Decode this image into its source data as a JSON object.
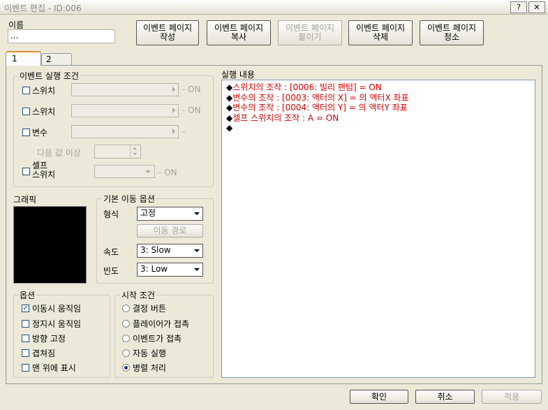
{
  "window": {
    "title": "이벤트 편집 - ID:006",
    "help_label": "?",
    "close_label": "✕"
  },
  "name": {
    "label": "이름",
    "value": "..."
  },
  "top_buttons": {
    "create": [
      "이벤트 페이지",
      "작성"
    ],
    "copy": [
      "이벤트 페이지",
      "복사"
    ],
    "paste": [
      "이벤트 페이지",
      "붙이기"
    ],
    "delete": [
      "이벤트 페이지",
      "삭제"
    ],
    "clear": [
      "이벤트 페이지",
      "청소"
    ]
  },
  "tabs": [
    {
      "label": "1"
    },
    {
      "label": "2"
    }
  ],
  "conditions": {
    "title": "이벤트 실행 조건",
    "switch1": {
      "label": "스위치",
      "suffix": "- ON"
    },
    "switch2": {
      "label": "스위치",
      "suffix": "- ON"
    },
    "variable": {
      "label": "변수",
      "suffix": "-",
      "sub_label": "다음 값 이상"
    },
    "self_switch": {
      "label1": "셀프",
      "label2": "스위치",
      "suffix": "- ON"
    }
  },
  "graphic": {
    "title": "그래픽"
  },
  "movement": {
    "title": "기본 이동 옵션",
    "type_label": "형식",
    "type_value": "고정",
    "route_button": "이동 경로",
    "speed_label": "속도",
    "speed_value": "3: Slow",
    "freq_label": "빈도",
    "freq_value": "3: Low"
  },
  "options": {
    "title": "옵션",
    "items": [
      {
        "label": "이동시 움직임",
        "checked": true
      },
      {
        "label": "정지시 움직임",
        "checked": false
      },
      {
        "label": "방향 고정",
        "checked": false
      },
      {
        "label": "겹쳐짐",
        "checked": false
      },
      {
        "label": "맨 위에 표시",
        "checked": false
      }
    ]
  },
  "trigger": {
    "title": "시작 조건",
    "items": [
      {
        "label": "결정 버튼",
        "checked": false
      },
      {
        "label": "플레이어가 접촉",
        "checked": false
      },
      {
        "label": "이벤트가 접촉",
        "checked": false
      },
      {
        "label": "자동 실행",
        "checked": false
      },
      {
        "label": "병렬 처리",
        "checked": true
      }
    ]
  },
  "contents": {
    "title": "실행 내용",
    "lines": [
      {
        "bullet": "◆",
        "text": "스위치의 조작 : [0006: 빌리 팬텀] = ON"
      },
      {
        "bullet": "◆",
        "text": "변수의 조작 : [0003: 액터의 X] = 의 액터X 좌표"
      },
      {
        "bullet": "◆",
        "text": "변수의 조작 : [0004: 액터의 Y] = 의 액터Y 좌표"
      },
      {
        "bullet": "◆",
        "text": "셀프 스위치의 조작 : A = ON"
      },
      {
        "bullet": "◆",
        "text": ""
      }
    ]
  },
  "footer": {
    "ok": "확인",
    "cancel": "취소",
    "apply": "적용"
  }
}
